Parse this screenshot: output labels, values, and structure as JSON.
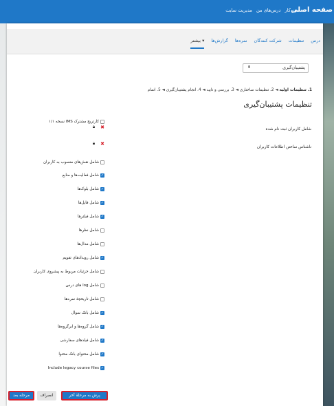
{
  "topbar": {
    "brand": "صفحه اصلی",
    "nav": [
      "میز کار",
      "درس‌های من",
      "مدیریت سایت"
    ]
  },
  "secondary_nav": {
    "tabs": [
      "درس",
      "تنظیمات",
      "شرکت کنندگان",
      "نمره‌ها",
      "گزارش‌ها",
      "بیشتر ▾"
    ],
    "active_index": 5
  },
  "backup_select": {
    "value": "پشتیبان‌گیری"
  },
  "stepper": {
    "step1": "1. تنظیمات اولیه",
    "rest": " ◄ 2. تنظیمات ساختاری ◄ 3. بررسی و تایید ◄ 4. انجام پشتیبان‌گیری ◄ 5. اتمام"
  },
  "page_title": "تنظیمات پشتیبان‌گیری",
  "row_labels": {
    "users": "شامل کاربران ثبت نام شده",
    "anonymize": "ناشناس ساختن اطلاعات کاربران"
  },
  "settings": [
    {
      "label": "کارتریج مشترک IMS نسخه ۱/۱",
      "checked": false
    },
    {
      "label": "شامل نقش‌های منسوب به کاربران",
      "checked": false
    },
    {
      "label": "شامل فعالیت‌ها و منابع",
      "checked": true
    },
    {
      "label": "شامل بلوک‌ها",
      "checked": true
    },
    {
      "label": "شامل فایل‌ها",
      "checked": true
    },
    {
      "label": "شامل فیلترها",
      "checked": true
    },
    {
      "label": "شامل نظرها",
      "checked": false
    },
    {
      "label": "شامل مدال‌ها",
      "checked": false
    },
    {
      "label": "شامل رویدادهای تقویم",
      "checked": true
    },
    {
      "label": "شامل جزئیات مربوط به پیشروی کاربران",
      "checked": false
    },
    {
      "label": "شامل log های درس",
      "checked": false
    },
    {
      "label": "شامل تاریخچهٔ نمره‌ها",
      "checked": false
    },
    {
      "label": "شامل بانک سوال",
      "checked": true
    },
    {
      "label": "شامل گروه‌ها و ابرگروه‌ها",
      "checked": true
    },
    {
      "label": "شامل فیلدهای سفارشی",
      "checked": true
    },
    {
      "label": "شامل محتوای بانک محتوا",
      "checked": true
    },
    {
      "label": "Include legacy course files",
      "checked": true
    }
  ],
  "buttons": {
    "next": "مرحله بعد",
    "cancel": "انصراف",
    "jump_last": "پرش به مرحلهٔ آخر"
  },
  "colors": {
    "accent": "#1f78c8",
    "highlight_outline": "#d6202b"
  }
}
